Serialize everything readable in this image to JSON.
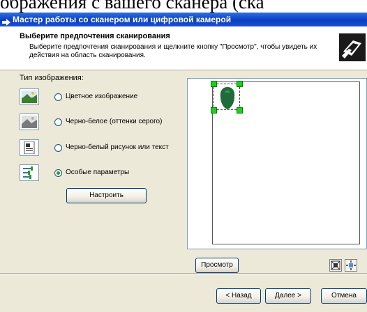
{
  "document": {
    "text": "ображения с вашего сканера (ска"
  },
  "window": {
    "title": "Мастер работы со сканером или цифровой камерой"
  },
  "header": {
    "title": "Выберите предпочтения сканирования",
    "subtitle": "Выберите предпочтения сканирования и щелкните кнопку \"Просмотр\", чтобы увидеть их действия на область сканирования."
  },
  "image_type": {
    "label": "Тип изображения:",
    "options": [
      {
        "label": "Цветное изображение",
        "icon": "color-picture-icon",
        "selected": false
      },
      {
        "label": "Черно-белое (оттенки серого)",
        "icon": "grayscale-picture-icon",
        "selected": false
      },
      {
        "label": "Черно-белый рисунок или текст",
        "icon": "text-document-icon",
        "selected": false
      },
      {
        "label": "Особые параметры",
        "icon": "custom-settings-icon",
        "selected": true
      }
    ],
    "configure_label": "Настроить"
  },
  "preview": {
    "button_label": "Просмотр"
  },
  "footer": {
    "back_label": "< Назад",
    "next_label": "Далее >",
    "cancel_label": "Отмена"
  },
  "colors": {
    "titlebar": "#0a3fc0",
    "dialog_bg": "#ece9d8",
    "selection_handle": "#1ad01a",
    "radio_checked": "#21a121"
  }
}
